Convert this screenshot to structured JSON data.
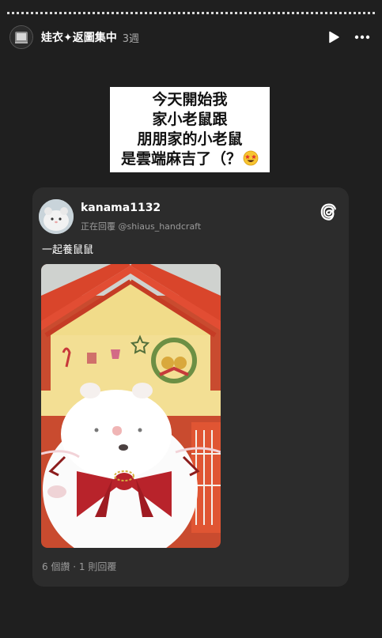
{
  "header": {
    "username": "娃衣✦返圖集中",
    "time": "3週",
    "icons": [
      "play-icon",
      "more-icon"
    ]
  },
  "sticker": {
    "lines": [
      "今天開始我",
      "家小老鼠跟",
      "朋朋家的小老鼠",
      "是雲端麻吉了（？"
    ],
    "emoji": "star-struck-emoji"
  },
  "post": {
    "author": "kanama1132",
    "reply_prefix": "正在回覆",
    "reply_handle": "@shiaus_handcraft",
    "text": "一起養鼠鼠",
    "stats": "6 個讚 · 1 則回覆",
    "logo": "threads-icon"
  },
  "colors": {
    "background": "#1f1f1f",
    "card": "#2c2c2c",
    "text": "#ffffff",
    "muted": "#9a9a9a",
    "house_roof": "#d9452b",
    "bow": "#b8232b"
  }
}
